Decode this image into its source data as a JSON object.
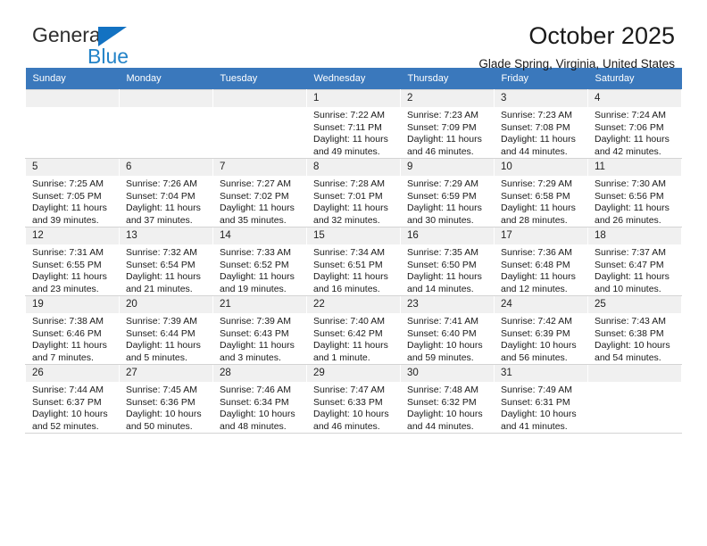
{
  "brand": {
    "name_part1": "General",
    "name_part2": "Blue",
    "triangle_color": "#1372c2",
    "text_color": "#2383c8"
  },
  "header": {
    "title": "October 2025",
    "subtitle": "Glade Spring, Virginia, United States"
  },
  "calendar": {
    "header_bg": "#3a78bc",
    "header_text_color": "#ffffff",
    "weekday_headers": [
      "Sunday",
      "Monday",
      "Tuesday",
      "Wednesday",
      "Thursday",
      "Friday",
      "Saturday"
    ],
    "labels": {
      "sunrise": "Sunrise:",
      "sunset": "Sunset:",
      "daylight": "Daylight:"
    },
    "weeks": [
      [
        {
          "day": "",
          "empty": true
        },
        {
          "day": "",
          "empty": true
        },
        {
          "day": "",
          "empty": true
        },
        {
          "day": "1",
          "sunrise": "Sunrise: 7:22 AM",
          "sunset": "Sunset: 7:11 PM",
          "daylight_line1": "Daylight: 11 hours",
          "daylight_line2": "and 49 minutes."
        },
        {
          "day": "2",
          "sunrise": "Sunrise: 7:23 AM",
          "sunset": "Sunset: 7:09 PM",
          "daylight_line1": "Daylight: 11 hours",
          "daylight_line2": "and 46 minutes."
        },
        {
          "day": "3",
          "sunrise": "Sunrise: 7:23 AM",
          "sunset": "Sunset: 7:08 PM",
          "daylight_line1": "Daylight: 11 hours",
          "daylight_line2": "and 44 minutes."
        },
        {
          "day": "4",
          "sunrise": "Sunrise: 7:24 AM",
          "sunset": "Sunset: 7:06 PM",
          "daylight_line1": "Daylight: 11 hours",
          "daylight_line2": "and 42 minutes."
        }
      ],
      [
        {
          "day": "5",
          "sunrise": "Sunrise: 7:25 AM",
          "sunset": "Sunset: 7:05 PM",
          "daylight_line1": "Daylight: 11 hours",
          "daylight_line2": "and 39 minutes."
        },
        {
          "day": "6",
          "sunrise": "Sunrise: 7:26 AM",
          "sunset": "Sunset: 7:04 PM",
          "daylight_line1": "Daylight: 11 hours",
          "daylight_line2": "and 37 minutes."
        },
        {
          "day": "7",
          "sunrise": "Sunrise: 7:27 AM",
          "sunset": "Sunset: 7:02 PM",
          "daylight_line1": "Daylight: 11 hours",
          "daylight_line2": "and 35 minutes."
        },
        {
          "day": "8",
          "sunrise": "Sunrise: 7:28 AM",
          "sunset": "Sunset: 7:01 PM",
          "daylight_line1": "Daylight: 11 hours",
          "daylight_line2": "and 32 minutes."
        },
        {
          "day": "9",
          "sunrise": "Sunrise: 7:29 AM",
          "sunset": "Sunset: 6:59 PM",
          "daylight_line1": "Daylight: 11 hours",
          "daylight_line2": "and 30 minutes."
        },
        {
          "day": "10",
          "sunrise": "Sunrise: 7:29 AM",
          "sunset": "Sunset: 6:58 PM",
          "daylight_line1": "Daylight: 11 hours",
          "daylight_line2": "and 28 minutes."
        },
        {
          "day": "11",
          "sunrise": "Sunrise: 7:30 AM",
          "sunset": "Sunset: 6:56 PM",
          "daylight_line1": "Daylight: 11 hours",
          "daylight_line2": "and 26 minutes."
        }
      ],
      [
        {
          "day": "12",
          "sunrise": "Sunrise: 7:31 AM",
          "sunset": "Sunset: 6:55 PM",
          "daylight_line1": "Daylight: 11 hours",
          "daylight_line2": "and 23 minutes."
        },
        {
          "day": "13",
          "sunrise": "Sunrise: 7:32 AM",
          "sunset": "Sunset: 6:54 PM",
          "daylight_line1": "Daylight: 11 hours",
          "daylight_line2": "and 21 minutes."
        },
        {
          "day": "14",
          "sunrise": "Sunrise: 7:33 AM",
          "sunset": "Sunset: 6:52 PM",
          "daylight_line1": "Daylight: 11 hours",
          "daylight_line2": "and 19 minutes."
        },
        {
          "day": "15",
          "sunrise": "Sunrise: 7:34 AM",
          "sunset": "Sunset: 6:51 PM",
          "daylight_line1": "Daylight: 11 hours",
          "daylight_line2": "and 16 minutes."
        },
        {
          "day": "16",
          "sunrise": "Sunrise: 7:35 AM",
          "sunset": "Sunset: 6:50 PM",
          "daylight_line1": "Daylight: 11 hours",
          "daylight_line2": "and 14 minutes."
        },
        {
          "day": "17",
          "sunrise": "Sunrise: 7:36 AM",
          "sunset": "Sunset: 6:48 PM",
          "daylight_line1": "Daylight: 11 hours",
          "daylight_line2": "and 12 minutes."
        },
        {
          "day": "18",
          "sunrise": "Sunrise: 7:37 AM",
          "sunset": "Sunset: 6:47 PM",
          "daylight_line1": "Daylight: 11 hours",
          "daylight_line2": "and 10 minutes."
        }
      ],
      [
        {
          "day": "19",
          "sunrise": "Sunrise: 7:38 AM",
          "sunset": "Sunset: 6:46 PM",
          "daylight_line1": "Daylight: 11 hours",
          "daylight_line2": "and 7 minutes."
        },
        {
          "day": "20",
          "sunrise": "Sunrise: 7:39 AM",
          "sunset": "Sunset: 6:44 PM",
          "daylight_line1": "Daylight: 11 hours",
          "daylight_line2": "and 5 minutes."
        },
        {
          "day": "21",
          "sunrise": "Sunrise: 7:39 AM",
          "sunset": "Sunset: 6:43 PM",
          "daylight_line1": "Daylight: 11 hours",
          "daylight_line2": "and 3 minutes."
        },
        {
          "day": "22",
          "sunrise": "Sunrise: 7:40 AM",
          "sunset": "Sunset: 6:42 PM",
          "daylight_line1": "Daylight: 11 hours",
          "daylight_line2": "and 1 minute."
        },
        {
          "day": "23",
          "sunrise": "Sunrise: 7:41 AM",
          "sunset": "Sunset: 6:40 PM",
          "daylight_line1": "Daylight: 10 hours",
          "daylight_line2": "and 59 minutes."
        },
        {
          "day": "24",
          "sunrise": "Sunrise: 7:42 AM",
          "sunset": "Sunset: 6:39 PM",
          "daylight_line1": "Daylight: 10 hours",
          "daylight_line2": "and 56 minutes."
        },
        {
          "day": "25",
          "sunrise": "Sunrise: 7:43 AM",
          "sunset": "Sunset: 6:38 PM",
          "daylight_line1": "Daylight: 10 hours",
          "daylight_line2": "and 54 minutes."
        }
      ],
      [
        {
          "day": "26",
          "sunrise": "Sunrise: 7:44 AM",
          "sunset": "Sunset: 6:37 PM",
          "daylight_line1": "Daylight: 10 hours",
          "daylight_line2": "and 52 minutes."
        },
        {
          "day": "27",
          "sunrise": "Sunrise: 7:45 AM",
          "sunset": "Sunset: 6:36 PM",
          "daylight_line1": "Daylight: 10 hours",
          "daylight_line2": "and 50 minutes."
        },
        {
          "day": "28",
          "sunrise": "Sunrise: 7:46 AM",
          "sunset": "Sunset: 6:34 PM",
          "daylight_line1": "Daylight: 10 hours",
          "daylight_line2": "and 48 minutes."
        },
        {
          "day": "29",
          "sunrise": "Sunrise: 7:47 AM",
          "sunset": "Sunset: 6:33 PM",
          "daylight_line1": "Daylight: 10 hours",
          "daylight_line2": "and 46 minutes."
        },
        {
          "day": "30",
          "sunrise": "Sunrise: 7:48 AM",
          "sunset": "Sunset: 6:32 PM",
          "daylight_line1": "Daylight: 10 hours",
          "daylight_line2": "and 44 minutes."
        },
        {
          "day": "31",
          "sunrise": "Sunrise: 7:49 AM",
          "sunset": "Sunset: 6:31 PM",
          "daylight_line1": "Daylight: 10 hours",
          "daylight_line2": "and 41 minutes."
        },
        {
          "day": "",
          "empty": true
        }
      ]
    ]
  }
}
